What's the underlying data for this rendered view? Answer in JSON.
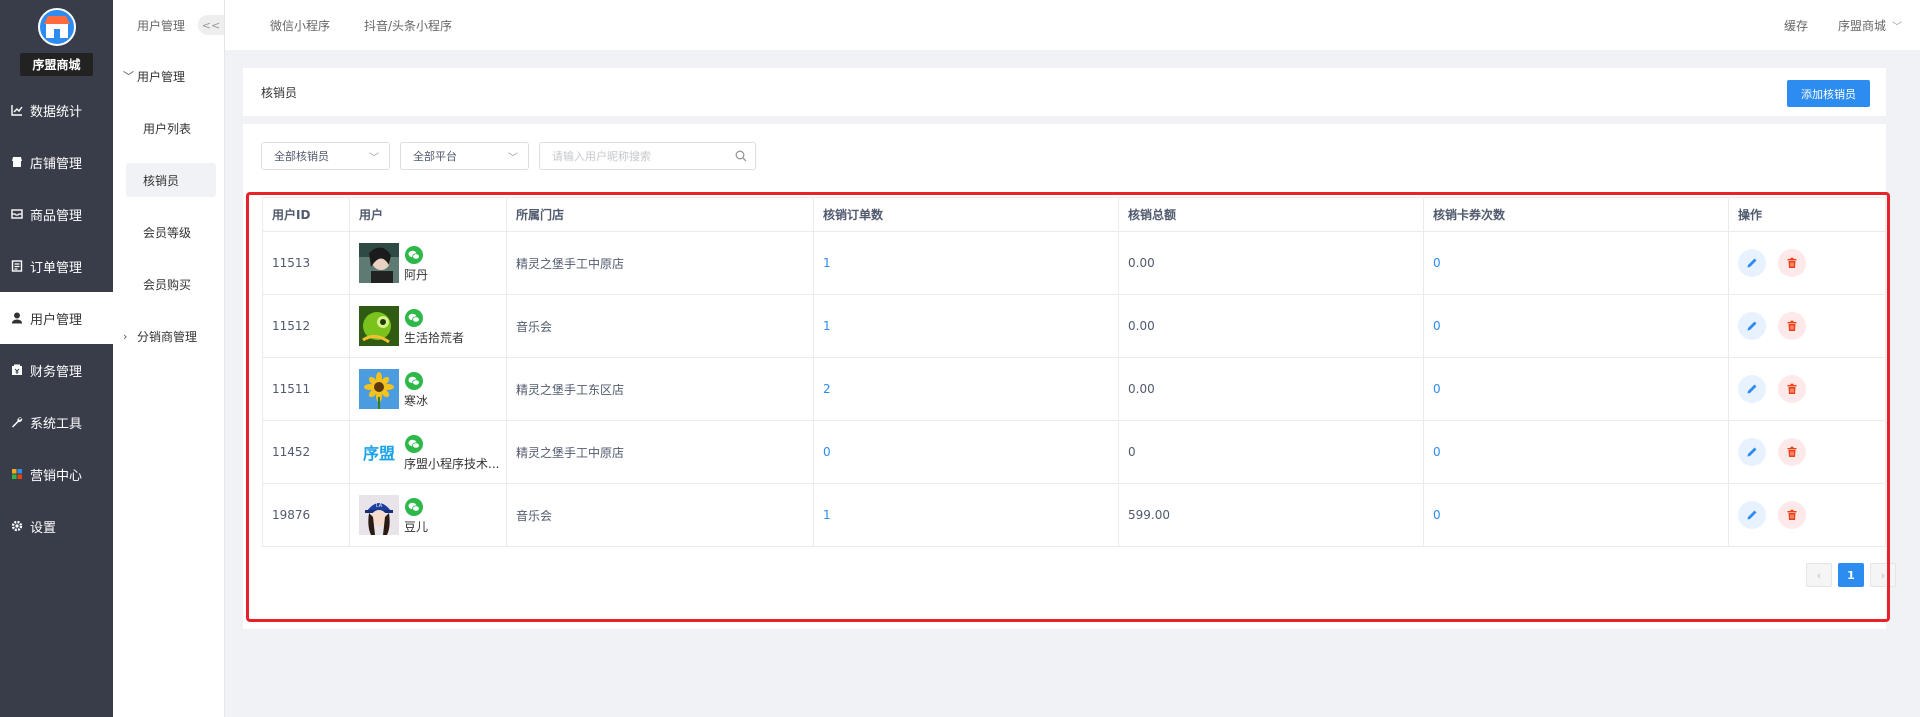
{
  "sidebar": {
    "store_name": "序盟商城",
    "items": [
      {
        "label": "数据统计",
        "icon": "chart-line-icon"
      },
      {
        "label": "店铺管理",
        "icon": "shop-icon"
      },
      {
        "label": "商品管理",
        "icon": "inbox-icon"
      },
      {
        "label": "订单管理",
        "icon": "order-list-icon"
      },
      {
        "label": "用户管理",
        "icon": "user-icon",
        "active": true
      },
      {
        "label": "财务管理",
        "icon": "wallet-icon"
      },
      {
        "label": "系统工具",
        "icon": "wrench-icon"
      },
      {
        "label": "营销中心",
        "icon": "marketing-icon"
      },
      {
        "label": "设置",
        "icon": "gear-icon"
      }
    ]
  },
  "subbar": {
    "header": "用户管理",
    "collapse": "<<",
    "group_user": "用户管理",
    "items": [
      "用户列表",
      "核销员",
      "会员等级",
      "会员购买"
    ],
    "group_distribution": "分销商管理"
  },
  "topbar": {
    "tabs": [
      "微信小程序",
      "抖音/头条小程序"
    ],
    "cache": "缓存",
    "account": "序盟商城"
  },
  "page": {
    "title": "核销员",
    "add_button": "添加核销员"
  },
  "filters": {
    "verifier": "全部核销员",
    "platform": "全部平台",
    "search_placeholder": "请输入用户昵称搜索"
  },
  "table": {
    "columns": [
      "用户ID",
      "用户",
      "所属门店",
      "核销订单数",
      "核销总额",
      "核销卡券次数",
      "操作"
    ],
    "rows": [
      {
        "id": "11513",
        "name": "阿丹",
        "store": "精灵之堡手工中原店",
        "orders": "1",
        "total": "0.00",
        "coupons": "0",
        "avatar": "person-dark-avatar"
      },
      {
        "id": "11512",
        "name": "生活拾荒者",
        "store": "音乐会",
        "orders": "1",
        "total": "0.00",
        "coupons": "0",
        "avatar": "green-chameleon-avatar"
      },
      {
        "id": "11511",
        "name": "寒冰",
        "store": "精灵之堡手工东区店",
        "orders": "2",
        "total": "0.00",
        "coupons": "0",
        "avatar": "sunflower-avatar"
      },
      {
        "id": "11452",
        "name": "序盟小程序技术...",
        "store": "精灵之堡手工中原店",
        "orders": "0",
        "total": "0",
        "coupons": "0",
        "avatar": "xumeng-logo-avatar",
        "avatar_text": "序盟"
      },
      {
        "id": "19876",
        "name": "豆儿",
        "store": "音乐会",
        "orders": "1",
        "total": "599.00",
        "coupons": "0",
        "avatar": "girl-cap-avatar"
      }
    ]
  },
  "pager": {
    "prev": "‹",
    "current": "1",
    "next": "›"
  },
  "colors": {
    "primary": "#2d8cf0",
    "sidebar_bg": "#393d49",
    "highlight": "#e8222a",
    "wechat": "#2fb84a",
    "delete": "#ed4014"
  }
}
